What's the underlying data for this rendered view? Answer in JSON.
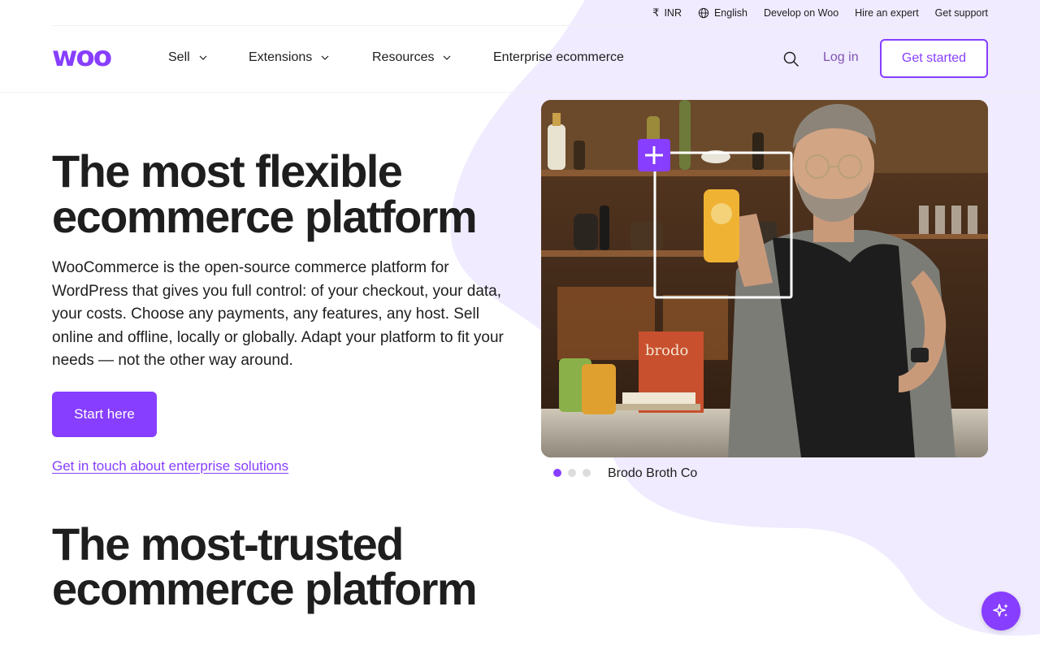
{
  "utility": {
    "currency_label": "INR",
    "language_label": "English",
    "develop_label": "Develop on Woo",
    "hire_label": "Hire an expert",
    "support_label": "Get support"
  },
  "nav": {
    "logo_text": "woo",
    "sell_label": "Sell",
    "extensions_label": "Extensions",
    "resources_label": "Resources",
    "enterprise_label": "Enterprise ecommerce",
    "login_label": "Log in",
    "get_started_label": "Get started"
  },
  "hero": {
    "title": "The most flexible ecommerce platform",
    "description": "WooCommerce is the open-source commerce platform for WordPress that gives you full control: of your checkout, your data, your costs. Choose any payments, any features, any host. Sell online and offline, locally or globally. Adapt your platform to fit your needs — not the other way around.",
    "start_label": "Start here",
    "enterprise_link": "Get in touch about enterprise solutions",
    "caption": "Brodo Broth Co",
    "carousel_active_index": 0,
    "carousel_count": 3,
    "product_word": "brodo"
  },
  "second": {
    "title": "The most-trusted ecommerce platform"
  },
  "colors": {
    "accent": "#873eff",
    "link_purple": "#7f54b3",
    "blob": "#f0ebff",
    "text": "#1e1e1e"
  },
  "icons": {
    "currency": "rupee-icon",
    "language": "globe-icon",
    "search": "search-icon",
    "ai": "sparkle-icon"
  }
}
